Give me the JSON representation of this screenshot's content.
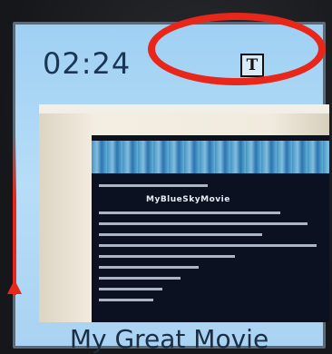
{
  "clip": {
    "duration": "02:24",
    "title": "My Great Movie",
    "title_badge_glyph": "T",
    "title_badge_icon": "title-text-icon"
  },
  "thumbnail": {
    "screen_caption": "MyBlueSkyMovie"
  },
  "colors": {
    "card_background": "#a9d3f2",
    "highlight_ring": "#e8261a",
    "text": "#1b3554"
  }
}
